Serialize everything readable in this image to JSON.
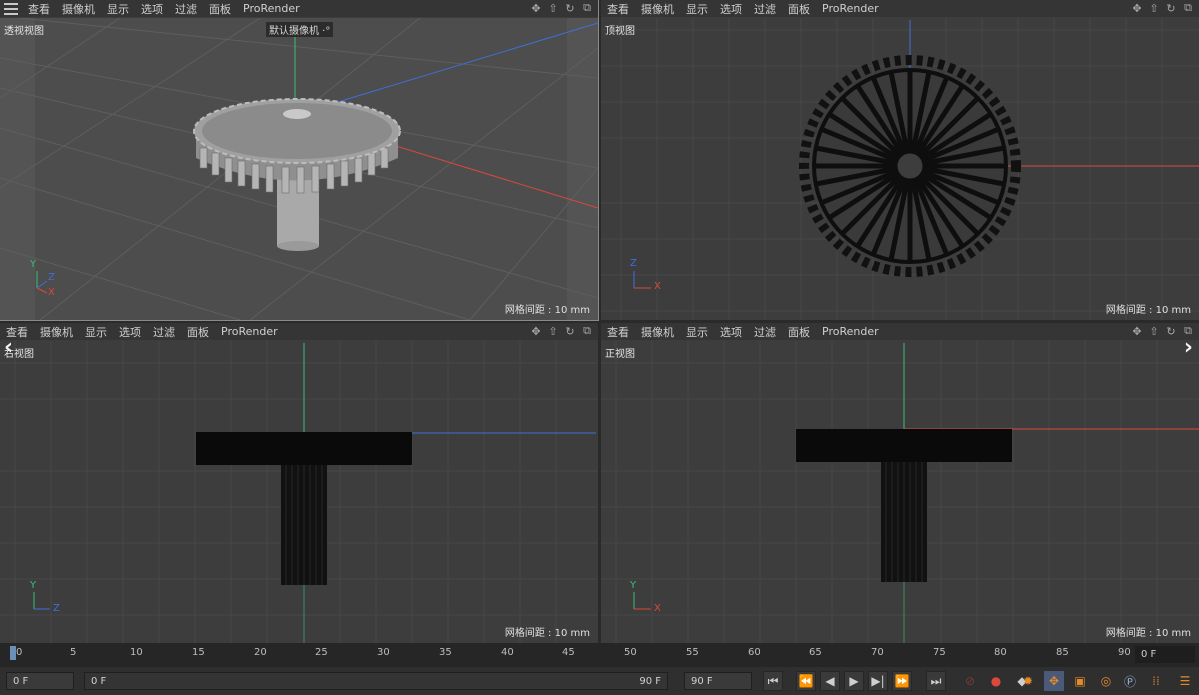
{
  "menus": {
    "top_left": [
      "查看",
      "摄像机",
      "显示",
      "选项",
      "过滤",
      "面板",
      "ProRender"
    ],
    "top_right": [
      "查看",
      "摄像机",
      "显示",
      "选项",
      "过滤",
      "面板",
      "ProRender"
    ],
    "bottom_left": [
      "查看",
      "摄像机",
      "显示",
      "选项",
      "过滤",
      "面板",
      "ProRender"
    ],
    "bottom_right": [
      "查看",
      "摄像机",
      "显示",
      "选项",
      "过滤",
      "面板",
      "ProRender"
    ]
  },
  "viewports": {
    "perspective": {
      "label": "透视视图",
      "camera": "默认摄像机 ·°",
      "grid": "网格间距 : 10 mm",
      "axes": {
        "y": "Y",
        "z": "Z",
        "x": "X"
      }
    },
    "top": {
      "label": "顶视图",
      "grid": "网格间距 : 10 mm",
      "axes": {
        "z": "Z",
        "x": "X"
      }
    },
    "right": {
      "label": "右视图",
      "grid": "网格间距 : 10 mm",
      "axes": {
        "y": "Y",
        "z": "Z"
      }
    },
    "front": {
      "label": "正视图",
      "grid": "网格间距 : 10 mm",
      "axes": {
        "y": "Y",
        "x": "X"
      }
    }
  },
  "colors": {
    "x_axis": "#d9493c",
    "y_axis": "#3bbf7a",
    "z_axis": "#3f6fd6",
    "viewport_bg": "#3d3d3d",
    "gear": "#9c9c9c"
  },
  "timeline": {
    "ticks": [
      "0",
      "5",
      "10",
      "15",
      "20",
      "25",
      "30",
      "35",
      "40",
      "45",
      "50",
      "55",
      "60",
      "65",
      "70",
      "75",
      "80",
      "85",
      "90"
    ],
    "current_frame": "0 F"
  },
  "bottom": {
    "start_frame": "0 F",
    "range_start": "0 F",
    "range_end": "90 F",
    "end_frame": "90 F"
  },
  "icons": {
    "transport": [
      "first-frame-icon",
      "prev-key-icon",
      "prev-frame-icon",
      "play-icon",
      "next-frame-icon",
      "next-key-icon",
      "last-frame-icon"
    ],
    "tools": [
      "record-icon",
      "autokey-icon",
      "keyframe-settings-icon",
      "move-key-icon",
      "scale-key-icon",
      "rotate-key-icon",
      "parameter-key-icon",
      "pla-icon",
      "timeline-layout-icon"
    ]
  }
}
